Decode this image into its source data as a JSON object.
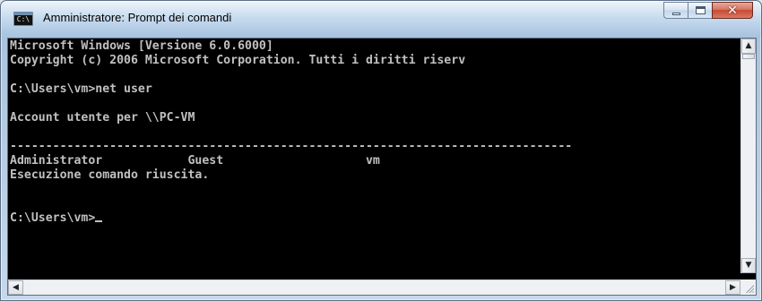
{
  "window": {
    "title": "Amministratore: Prompt dei comandi",
    "icon_label": "C:\\"
  },
  "console": {
    "lines": [
      "Microsoft Windows [Versione 6.0.6000]",
      "Copyright (c) 2006 Microsoft Corporation. Tutti i diritti riserv",
      "",
      "C:\\Users\\vm>net user",
      "",
      "Account utente per \\\\PC-VM",
      "",
      "-------------------------------------------------------------------------------",
      "Administrator            Guest                    vm",
      "Esecuzione comando riuscita.",
      "",
      "",
      "C:\\Users\\vm>"
    ]
  },
  "scrollbars": {
    "up_glyph": "▲",
    "down_glyph": "▼",
    "left_glyph": "◀",
    "right_glyph": "▶"
  },
  "caption": {
    "close_glyph": "✕"
  },
  "colors": {
    "console_bg": "#000000",
    "console_fg": "#c0c0c0",
    "close_button": "#c74a35"
  },
  "icons": {
    "app": "console-icon",
    "minimize": "minimize-icon",
    "maximize": "maximize-icon",
    "close": "close-icon",
    "resize": "resize-grip-icon"
  }
}
